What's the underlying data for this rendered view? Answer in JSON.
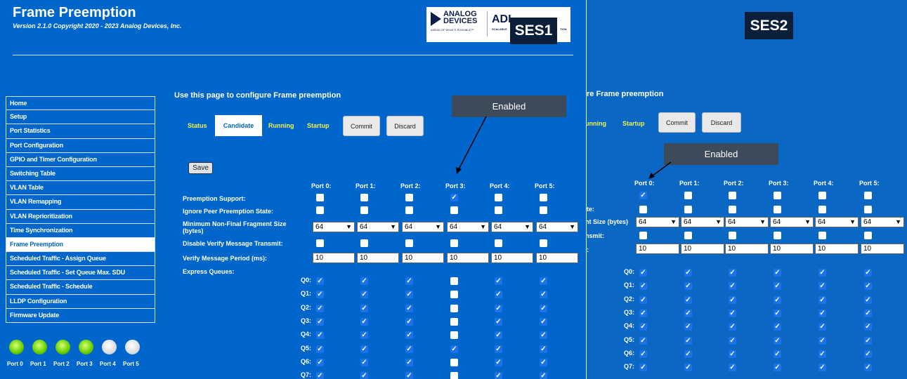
{
  "ses1": {
    "title": "Frame Preemption",
    "version": "Version 2.1.0 Copyright 2020 - 2023 Analog Devices, Inc.",
    "logo_analog": "ANALOG",
    "logo_devices": "DEVICES",
    "logo_tagline": "AHEAD OF WHAT'S POSSIBLE™",
    "logo_adi": "ADI",
    "logo_adi_sub": "SCALABLE",
    "logo_adi_tail": "TION",
    "label": "SES1",
    "nav": [
      "Home",
      "Setup",
      "Port Statistics",
      "Port Configuration",
      "GPIO and Timer Configuration",
      "Switching Table",
      "VLAN Table",
      "VLAN Remapping",
      "VLAN Reprioritization",
      "Time Synchronization",
      "Frame Preemption",
      "Scheduled Traffic - Assign Queue",
      "Scheduled Traffic - Set Queue Max. SDU",
      "Scheduled Traffic - Schedule",
      "LLDP Configuration",
      "Firmware Update"
    ],
    "active_nav": "Frame Preemption",
    "leds": [
      {
        "label": "Port 0",
        "state": "green"
      },
      {
        "label": "Port 1",
        "state": "green"
      },
      {
        "label": "Port 2",
        "state": "green"
      },
      {
        "label": "Port 3",
        "state": "green"
      },
      {
        "label": "Port 4",
        "state": "white"
      },
      {
        "label": "Port 5",
        "state": "white"
      }
    ],
    "heading": "Use this page to configure Frame preemption",
    "tabs": {
      "status": "Status",
      "candidate": "Candidate",
      "running": "Running",
      "startup": "Startup"
    },
    "commit": "Commit",
    "discard": "Discard",
    "callout": "Enabled",
    "save": "Save",
    "ports": [
      "Port 0:",
      "Port 1:",
      "Port 2:",
      "Port 3:",
      "Port 4:",
      "Port 5:"
    ],
    "labels": {
      "preemption_support": "Preemption Support:",
      "ignore_peer": "Ignore Peer Preemption State:",
      "min_frag": "Minimum Non-Final Fragment Size (bytes)",
      "disable_verify": "Disable Verify Message Transmit:",
      "verify_period": "Verify Message Period (ms):",
      "express_queues": "Express Queues:"
    },
    "preemption_support": [
      false,
      false,
      false,
      true,
      false,
      false
    ],
    "ignore_peer": [
      false,
      false,
      false,
      false,
      false,
      false
    ],
    "min_frag": [
      "64",
      "64",
      "64",
      "64",
      "64",
      "64"
    ],
    "disable_verify": [
      false,
      false,
      false,
      false,
      false,
      false
    ],
    "verify_period": [
      "10",
      "10",
      "10",
      "10",
      "10",
      "10"
    ],
    "queues": [
      "Q0:",
      "Q1:",
      "Q2:",
      "Q3:",
      "Q4:",
      "Q5:",
      "Q6:",
      "Q7:"
    ],
    "express": [
      [
        true,
        true,
        true,
        false,
        true,
        true
      ],
      [
        true,
        true,
        true,
        false,
        true,
        true
      ],
      [
        true,
        true,
        true,
        false,
        true,
        true
      ],
      [
        true,
        true,
        true,
        false,
        true,
        true
      ],
      [
        true,
        true,
        true,
        false,
        true,
        true
      ],
      [
        true,
        true,
        true,
        true,
        true,
        true
      ],
      [
        true,
        true,
        true,
        false,
        true,
        true
      ],
      [
        true,
        true,
        true,
        false,
        true,
        true
      ]
    ]
  },
  "ses2": {
    "label": "SES2",
    "heading_partial": "re Frame preemption",
    "tabs": {
      "running": "unning",
      "startup": "Startup"
    },
    "commit": "Commit",
    "discard": "Discard",
    "callout": "Enabled",
    "ports": [
      "Port 0:",
      "Port 1:",
      "Port 2:",
      "Port 3:",
      "Port 4:",
      "Port 5:"
    ],
    "labels": {
      "ignore_peer": "te:",
      "min_frag": "nt Size (bytes)",
      "disable_verify": "nsmit:",
      "verify_period": ":"
    },
    "preemption_support": [
      true,
      false,
      false,
      false,
      false,
      false
    ],
    "ignore_peer": [
      false,
      false,
      false,
      false,
      false,
      false
    ],
    "min_frag": [
      "64",
      "64",
      "64",
      "64",
      "64",
      "64"
    ],
    "disable_verify": [
      false,
      false,
      false,
      false,
      false,
      false
    ],
    "verify_period": [
      "10",
      "10",
      "10",
      "10",
      "10",
      "10"
    ],
    "queues": [
      "Q0:",
      "Q1:",
      "Q2:",
      "Q3:",
      "Q4:",
      "Q5:",
      "Q6:",
      "Q7:"
    ],
    "express": [
      [
        true,
        true,
        true,
        true,
        true,
        true
      ],
      [
        true,
        true,
        true,
        true,
        true,
        true
      ],
      [
        true,
        true,
        true,
        true,
        true,
        true
      ],
      [
        true,
        true,
        true,
        true,
        true,
        true
      ],
      [
        true,
        true,
        true,
        true,
        true,
        true
      ],
      [
        true,
        true,
        true,
        true,
        true,
        true
      ],
      [
        true,
        true,
        true,
        true,
        true,
        true
      ],
      [
        true,
        true,
        true,
        true,
        true,
        true
      ]
    ]
  },
  "colors": {
    "bg": "#0066cc",
    "tab_text": "#f2f24a",
    "check": "#1a73e8",
    "callout": "#3d4a5a",
    "led_on": "#6fd100"
  }
}
